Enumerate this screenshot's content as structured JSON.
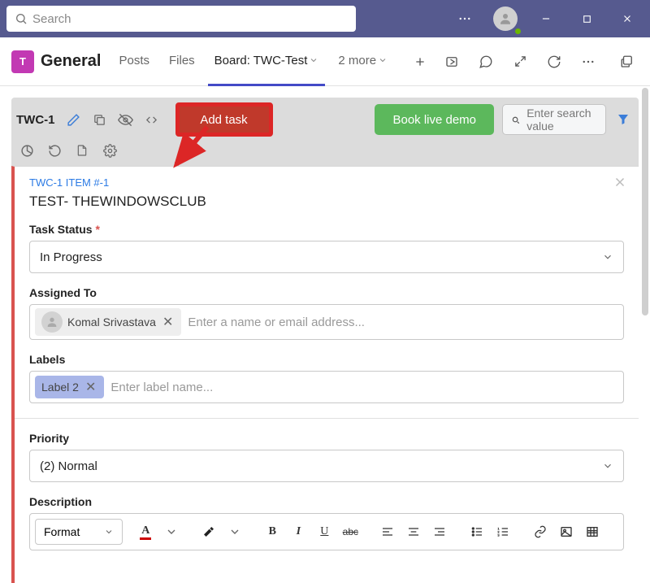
{
  "titlebar": {
    "search_placeholder": "Search"
  },
  "channel": {
    "team_letter": "T",
    "name": "General",
    "tabs": {
      "posts": "Posts",
      "files": "Files",
      "board": "Board: TWC-Test",
      "more": "2 more"
    }
  },
  "app_toolbar": {
    "project_label": "TWC-1",
    "add_task_label": "Add task",
    "book_demo_label": "Book live demo",
    "search_placeholder": "Enter search value"
  },
  "task": {
    "id_label": "TWC-1 ITEM #-1",
    "title": "TEST- THEWINDOWSCLUB",
    "status": {
      "label": "Task Status",
      "required": "*",
      "value": "In Progress"
    },
    "assigned": {
      "label": "Assigned To",
      "chip_name": "Komal Srivastava",
      "placeholder": "Enter a name or email address..."
    },
    "labels": {
      "label": "Labels",
      "chip_name": "Label 2",
      "placeholder": "Enter label name..."
    },
    "priority": {
      "label": "Priority",
      "value": "(2) Normal"
    },
    "description": {
      "label": "Description",
      "format_label": "Format"
    }
  }
}
